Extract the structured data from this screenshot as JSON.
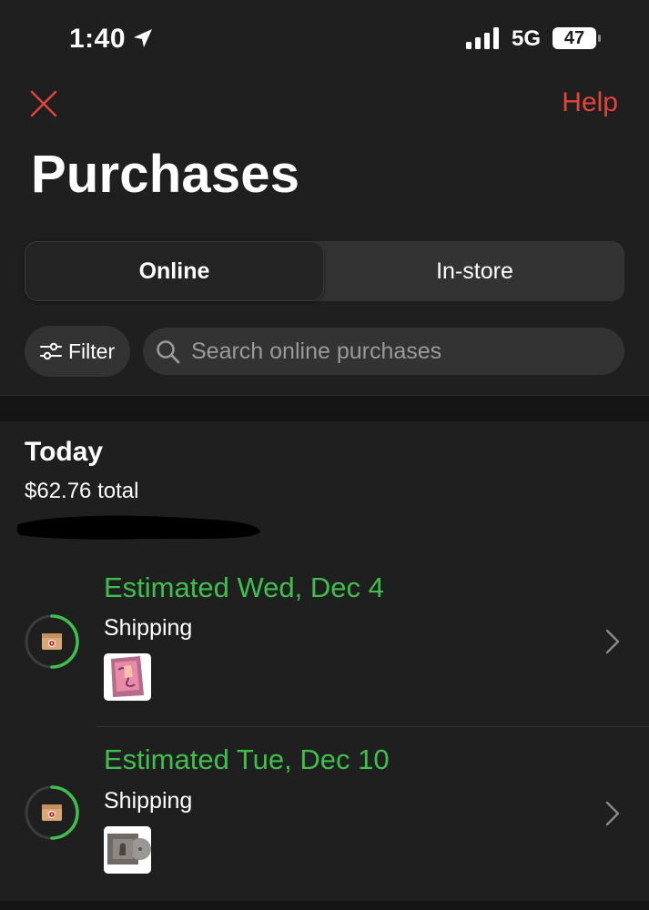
{
  "status_bar": {
    "time": "1:40",
    "network": "5G",
    "battery": "47"
  },
  "header": {
    "help_label": "Help",
    "title": "Purchases"
  },
  "tabs": [
    {
      "label": "Online",
      "selected": true
    },
    {
      "label": "In-store",
      "selected": false
    }
  ],
  "filter": {
    "label": "Filter"
  },
  "search": {
    "placeholder": "Search online purchases"
  },
  "sections": [
    {
      "heading": "Today",
      "total": "$62.76 total",
      "orders": [
        {
          "estimate": "Estimated Wed, Dec 4",
          "status": "Shipping",
          "icon": "package-icon"
        },
        {
          "estimate": "Estimated Tue, Dec 10",
          "status": "Shipping",
          "icon": "package-icon"
        }
      ]
    }
  ],
  "colors": {
    "accent_red": "#e2453c",
    "accent_green": "#3fbf4e",
    "background": "#1f1f1f"
  }
}
